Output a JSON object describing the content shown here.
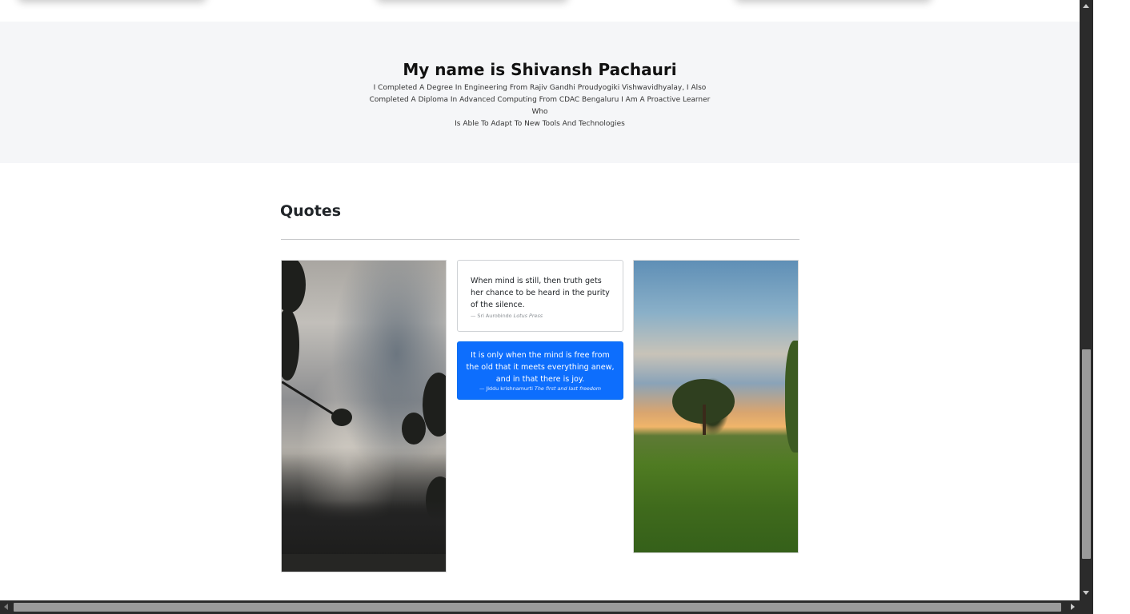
{
  "about": {
    "title": "My name is Shivansh Pachauri",
    "description_lines": [
      "I Completed A Degree In Engineering From Rajiv Gandhi Proudyogiki Vishwavidhyalay, I Also",
      "Completed A Diploma In Advanced Computing From CDAC Bengaluru I Am A Proactive Learner Who",
      "Is Able To Adapt To New Tools And Technologies"
    ]
  },
  "quotes": {
    "heading": "Quotes",
    "items": [
      {
        "text": "When mind is still, then truth gets her chance to be heard in the purity of the silence.",
        "author": "— Sri Aurobindo",
        "source": "Lotus Press"
      },
      {
        "text": "It is only when the mind is free from the old that it meets everything anew, and in that there is joy.",
        "author": "— Jiddu krishnamurti",
        "source": "The first and last freedom"
      }
    ],
    "images": [
      {
        "subject": "stormy sky with tree silhouettes"
      },
      {
        "subject": "tree in green meadow at sunset"
      }
    ]
  },
  "colors": {
    "about_bg": "#f5f6f8",
    "primary": "#0d6efd",
    "text": "#212529"
  }
}
